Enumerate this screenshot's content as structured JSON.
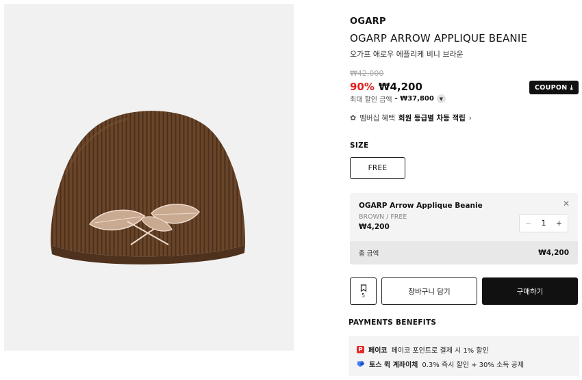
{
  "product": {
    "brand": "OGARP",
    "title": "OGARP ARROW APPLIQUE BEANIE",
    "subtitle": "오가프 애로우 에플리케 비니 브라운",
    "original_price": "₩42,000",
    "discount": "90%",
    "price": "₩4,200",
    "coupon_label": "COUPON",
    "max_discount_label": "최대 할인 금액",
    "max_discount_value": "- ₩37,800",
    "membership_label": "멤버십 혜택",
    "membership_value": "회원 등급별 차등 적립",
    "image_icon": "beanie-image",
    "accent_color": "#e02020"
  },
  "size": {
    "label": "SIZE",
    "selected": "FREE"
  },
  "selected_option": {
    "name": "OGARP Arrow Applique Beanie",
    "variant": "BROWN / FREE",
    "price": "₩4,200",
    "quantity": "1",
    "total_label": "총 금액",
    "total_value": "₩4,200"
  },
  "actions": {
    "bookmark_count": "5",
    "cart_label": "장바구니 담기",
    "buy_label": "구매하기"
  },
  "payments": {
    "title": "PAYMENTS BENEFITS",
    "items": [
      {
        "brand": "페이코",
        "text": "페이코 포인트로 결제 시 1% 할인",
        "icon": "payco-icon"
      },
      {
        "brand": "토스 퀵 계좌이체",
        "text": "0.3% 즉시 할인 + 30% 소득 공제",
        "icon": "toss-icon"
      }
    ]
  }
}
